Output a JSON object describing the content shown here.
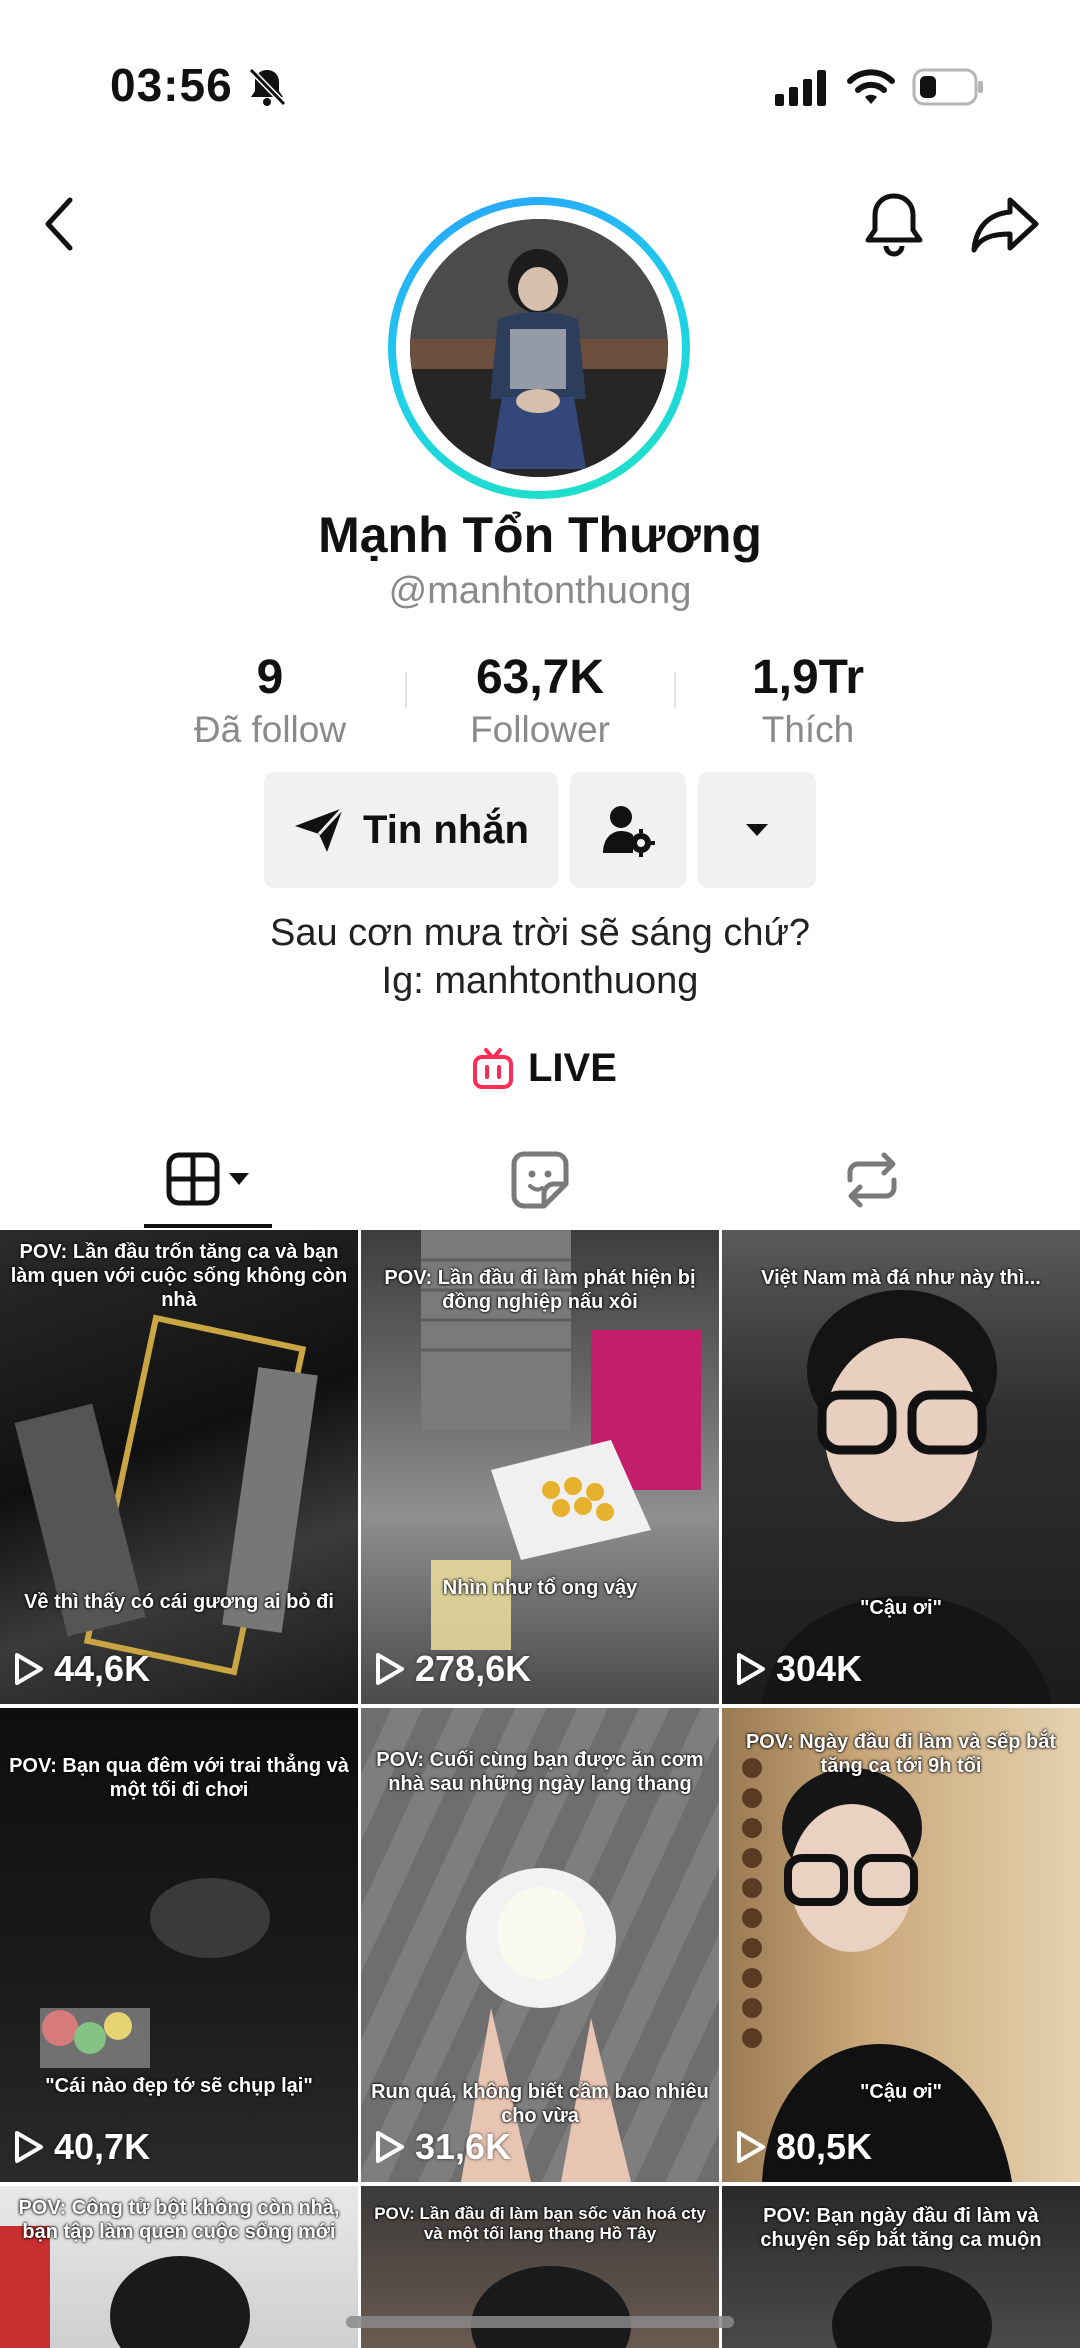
{
  "status_bar": {
    "time": "03:56"
  },
  "profile": {
    "name": "Mạnh Tổn Thương",
    "handle": "@manhtonthuong",
    "stats": [
      {
        "value": "9",
        "label": "Đã follow"
      },
      {
        "value": "63,7K",
        "label": "Follower"
      },
      {
        "value": "1,9Tr",
        "label": "Thích"
      }
    ],
    "message_button": "Tin nhắn",
    "bio_line1": "Sau cơn mưa trời sẽ sáng chứ?",
    "bio_line2": "Ig: manhtonthuong",
    "live_label": "LIVE"
  },
  "icons": {
    "back": "chevron-left-icon",
    "notify": "bell-icon",
    "share": "share-arrow-icon",
    "message": "paper-plane-icon",
    "user_settings": "user-gear-icon",
    "more": "caret-down-icon",
    "tabs": [
      "grid-icon",
      "sticker-icon",
      "repost-icon"
    ]
  },
  "colors": {
    "avatar_ring_start": "#2aa1ff",
    "avatar_ring_end": "#1fe3c3",
    "live": "#fe2c55"
  },
  "videos": [
    {
      "caption_top": "POV: Lần đầu trốn tăng ca và bạn làm quen với cuộc sống không còn nhà",
      "caption_bottom": "Về thì thấy có cái gương ai bỏ đi",
      "views": "44,6K"
    },
    {
      "caption_top": "POV: Lần đầu đi làm phát hiện bị đồng nghiệp nấu xôi",
      "caption_bottom": "Nhìn như tổ ong vậy",
      "views": "278,6K"
    },
    {
      "caption_top": "Việt Nam mà đá như này thì...",
      "caption_bottom": "\"Cậu ơi\"",
      "views": "304K"
    },
    {
      "caption_top": "POV: Bạn qua đêm với trai thẳng và một tối đi chơi",
      "caption_bottom": "\"Cái nào đẹp tớ sẽ chụp lại\"",
      "views": "40,7K"
    },
    {
      "caption_top": "POV: Cuối cùng bạn được ăn cơm nhà sau những ngày lang thang",
      "caption_bottom": "Run quá, không biết cầm bao nhiêu cho vừa",
      "views": "31,6K"
    },
    {
      "caption_top": "POV: Ngày đầu đi làm và sếp bắt tăng ca tới 9h tối",
      "caption_bottom": "\"Cậu ơi\"",
      "views": "80,5K"
    },
    {
      "caption_top": "POV: Công tử bột không còn nhà, bạn tập làm quen cuộc sống mới",
      "caption_bottom": "",
      "views": ""
    },
    {
      "caption_top": "POV: Lần đầu đi làm bạn sốc văn hoá cty và một tối lang thang Hồ Tây",
      "caption_bottom": "",
      "views": ""
    },
    {
      "caption_top": "POV: Bạn ngày đầu đi làm và chuyện sếp bắt tăng ca muộn",
      "caption_bottom": "",
      "views": ""
    }
  ]
}
